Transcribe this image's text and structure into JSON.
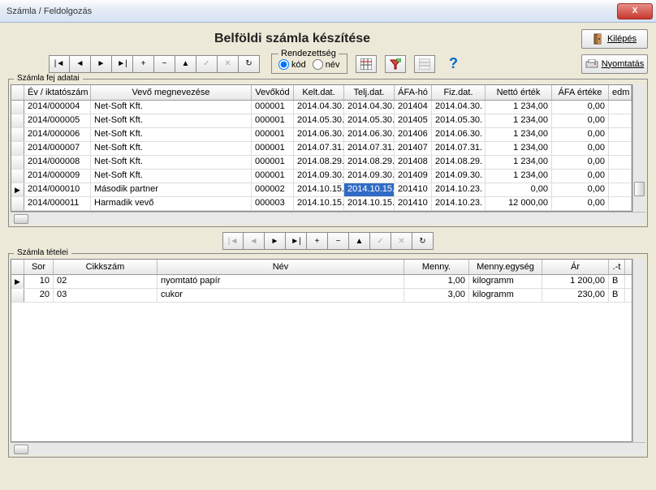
{
  "window": {
    "title": "Számla / Feldolgozás"
  },
  "page": {
    "title": "Belföldi számla készítése"
  },
  "buttons": {
    "exit": "Kilépés",
    "print": "Nyomtatás"
  },
  "sort": {
    "title": "Rendezettség",
    "opt_code": "kód",
    "opt_name": "név"
  },
  "group1": {
    "title": "Számla fej adatai"
  },
  "group2": {
    "title": "Számla tételei"
  },
  "headers1": {
    "c1": "Év / iktatószám",
    "c2": "Vevő megnevezése",
    "c3": "Vevőkód",
    "c4": "Kelt.dat.",
    "c5": "Telj.dat.",
    "c6": "ÁFA-hó",
    "c7": "Fiz.dat.",
    "c8": "Nettó érték",
    "c9": "ÁFA értéke",
    "c10": "edm"
  },
  "rows1": [
    {
      "id": "2014/000004",
      "name": "Net-Soft Kft.",
      "code": "000001",
      "kelt": "2014.04.30.",
      "telj": "2014.04.30.",
      "afaho": "201404",
      "fiz": "2014.04.30.",
      "netto": "1 234,00",
      "afa": "0,00"
    },
    {
      "id": "2014/000005",
      "name": "Net-Soft Kft.",
      "code": "000001",
      "kelt": "2014.05.30.",
      "telj": "2014.05.30.",
      "afaho": "201405",
      "fiz": "2014.05.30.",
      "netto": "1 234,00",
      "afa": "0,00"
    },
    {
      "id": "2014/000006",
      "name": "Net-Soft Kft.",
      "code": "000001",
      "kelt": "2014.06.30.",
      "telj": "2014.06.30.",
      "afaho": "201406",
      "fiz": "2014.06.30.",
      "netto": "1 234,00",
      "afa": "0,00"
    },
    {
      "id": "2014/000007",
      "name": "Net-Soft Kft.",
      "code": "000001",
      "kelt": "2014.07.31.",
      "telj": "2014.07.31.",
      "afaho": "201407",
      "fiz": "2014.07.31.",
      "netto": "1 234,00",
      "afa": "0,00"
    },
    {
      "id": "2014/000008",
      "name": "Net-Soft Kft.",
      "code": "000001",
      "kelt": "2014.08.29.",
      "telj": "2014.08.29.",
      "afaho": "201408",
      "fiz": "2014.08.29.",
      "netto": "1 234,00",
      "afa": "0,00"
    },
    {
      "id": "2014/000009",
      "name": "Net-Soft Kft.",
      "code": "000001",
      "kelt": "2014.09.30.",
      "telj": "2014.09.30.",
      "afaho": "201409",
      "fiz": "2014.09.30.",
      "netto": "1 234,00",
      "afa": "0,00"
    },
    {
      "id": "2014/000010",
      "name": "Második partner",
      "code": "000002",
      "kelt": "2014.10.15.",
      "telj": "2014.10.15.",
      "afaho": "201410",
      "fiz": "2014.10.23.",
      "netto": "0,00",
      "afa": "0,00",
      "sel": true,
      "cur": true
    },
    {
      "id": "2014/000011",
      "name": "Harmadik vevő",
      "code": "000003",
      "kelt": "2014.10.15.",
      "telj": "2014.10.15.",
      "afaho": "201410",
      "fiz": "2014.10.23.",
      "netto": "12 000,00",
      "afa": "0,00"
    }
  ],
  "headers2": {
    "c1": "Sor",
    "c2": "Cikkszám",
    "c3": "Név",
    "c4": "Menny.",
    "c5": "Menny.egység",
    "c6": "Ár",
    "c7": ".-t"
  },
  "rows2": [
    {
      "sor": "10",
      "cikk": "02",
      "nev": "nyomtató papír",
      "menny": "1,00",
      "egys": "kilogramm",
      "ar": "1 200,00",
      "t": "B",
      "cur": true
    },
    {
      "sor": "20",
      "cikk": "03",
      "nev": "cukor",
      "menny": "3,00",
      "egys": "kilogramm",
      "ar": "230,00",
      "t": "B"
    }
  ],
  "nav_icons": {
    "first": "|◄",
    "prev": "◄",
    "next": "►",
    "last": "►|",
    "add": "+",
    "del": "−",
    "up": "▲",
    "check": "✓",
    "x": "✕",
    "refresh": "↻"
  }
}
